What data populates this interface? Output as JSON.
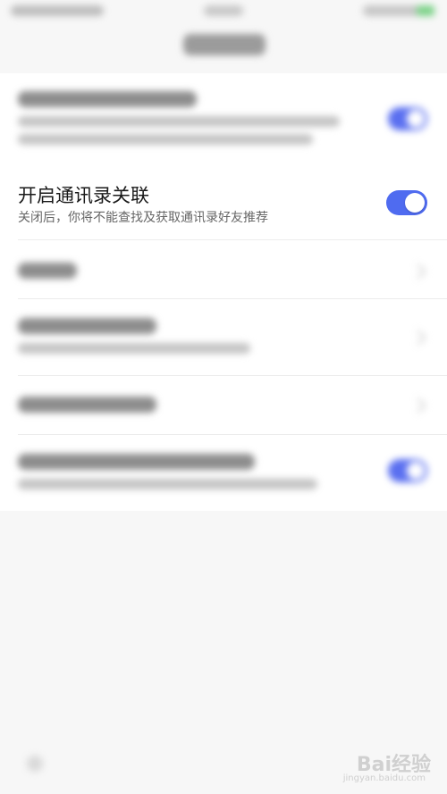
{
  "focused_setting": {
    "title": "开启通讯录关联",
    "description": "关闭后，你将不能查找及获取通讯录好友推荐",
    "toggle_on": true
  },
  "watermark": {
    "brand": "Bai经验",
    "url": "jingyan.baidu.com"
  },
  "colors": {
    "toggle_on": "#4f6bf0",
    "background": "#f7f7f7"
  }
}
